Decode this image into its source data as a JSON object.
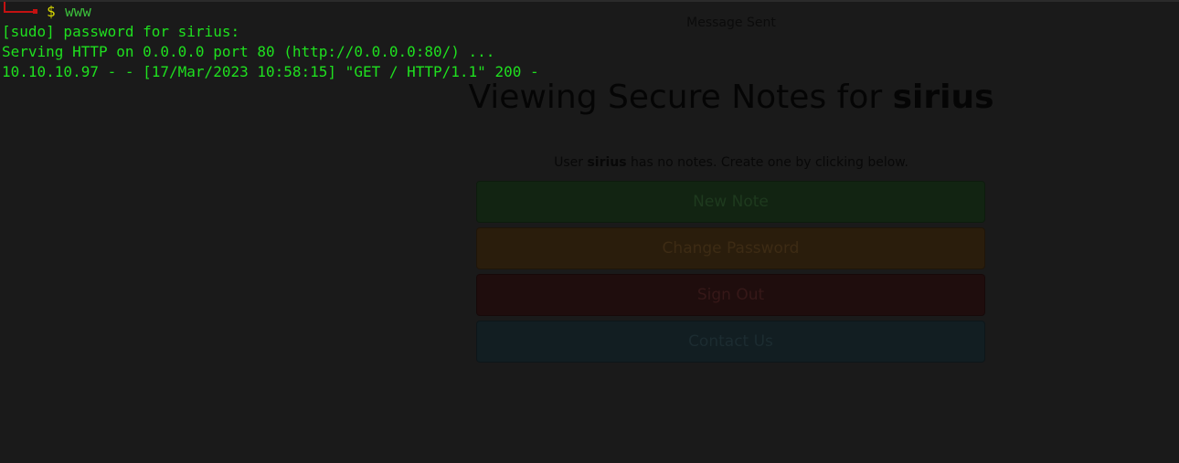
{
  "terminal": {
    "prompt_symbol": "$",
    "command": "www",
    "output_lines": [
      "[sudo] password for sirius:",
      "Serving HTTP on 0.0.0.0 port 80 (http://0.0.0.0:80/) ...",
      "10.10.10.97 - - [17/Mar/2023 10:58:15] \"GET / HTTP/1.1\" 200 -"
    ],
    "prompt_color": "#c41111",
    "text_color": "#1fe01f"
  },
  "web": {
    "flash_message": "Message Sent",
    "heading_prefix": "Viewing Secure Notes for",
    "heading_user": "sirius",
    "notes_prefix": "User",
    "notes_user": "sirius",
    "notes_suffix": "has no notes. Create one by clicking below.",
    "buttons": {
      "new_note": "New Note",
      "change_password": "Change Password",
      "sign_out": "Sign Out",
      "contact_us": "Contact Us"
    }
  }
}
